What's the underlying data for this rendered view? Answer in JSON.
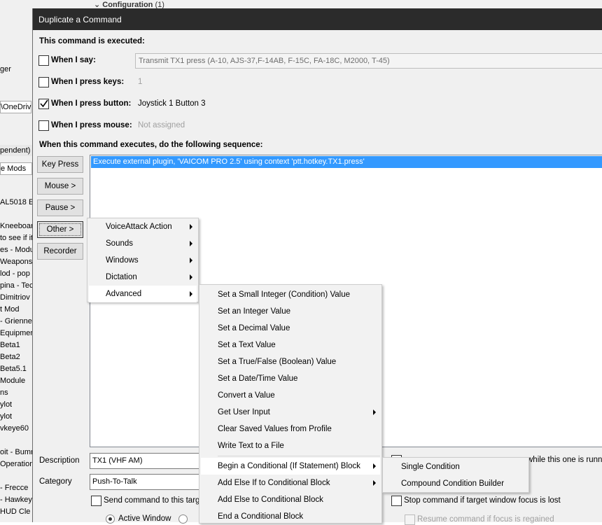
{
  "background": {
    "top_label": "Configuration",
    "top_count": "(1)",
    "left_fragments": [
      "ger",
      "\\OneDriv",
      "pendent) -",
      "e Mods",
      "AL5018 E",
      "Kneeboar",
      "to see if it",
      "es - Modu",
      "Weapons I",
      "lod  - pop",
      "pina - Tec",
      "Dimitriov",
      "t Mod",
      "- Griennel",
      "Equipmen",
      "Beta1",
      "Beta2",
      "Beta5.1",
      "Module",
      "ns",
      "ylot",
      "ylot",
      "vkeye60",
      "oit - Bumm",
      "Operation",
      "- Frecce",
      "- Hawkey",
      "HUD Cle"
    ]
  },
  "dialog": {
    "title": "Duplicate a Command",
    "executed_header": "This command is executed:",
    "when_say": {
      "label": "When I say:",
      "value": "Transmit TX1 press (A-10, AJS-37,F-14AB, F-15C, FA-18C, M2000, T-45)",
      "checked": false
    },
    "when_keys": {
      "label": "When I press keys:",
      "value": "1",
      "checked": false
    },
    "when_button": {
      "label": "When I press button:",
      "value": "Joystick 1 Button 3",
      "checked": true
    },
    "when_mouse": {
      "label": "When I press mouse:",
      "value": "Not assigned",
      "checked": false
    },
    "sequence_header": "When this command executes, do the following sequence:",
    "buttons": {
      "key_press": "Key Press",
      "mouse": "Mouse >",
      "pause": "Pause >",
      "other": "Other >",
      "recorder": "Recorder"
    },
    "sequence_items": [
      "Execute external plugin, 'VAICOM PRO 2.5' using context 'ptt.hotkey.TX1.press'"
    ],
    "description_label": "Description",
    "description_value": "TX1 (VHF AM)",
    "category_label": "Category",
    "category_value": "Push-To-Talk",
    "send_to_target": "Send command to this targ",
    "active_window": "Active Window",
    "right_text_running": "while this one is runni",
    "stop_focus_lost": "Stop command if target window focus is lost",
    "resume_focus": "Resume command if focus is regained"
  },
  "menu_other": [
    "VoiceAttack Action",
    "Sounds",
    "Windows",
    "Dictation",
    "Advanced"
  ],
  "menu_advanced": [
    "Set a Small Integer (Condition) Value",
    "Set an Integer Value",
    "Set a Decimal Value",
    "Set a Text Value",
    "Set a True/False (Boolean) Value",
    "Set a Date/Time Value",
    "Convert a Value",
    "Get User Input",
    "Clear Saved Values from Profile",
    "Write Text to a File",
    "Begin a Conditional (If Statement) Block",
    "Add Else If to Conditional Block",
    "Add Else to Conditional Block",
    "End a Conditional Block"
  ],
  "menu_conditional": [
    "Single Condition",
    "Compound Condition Builder"
  ]
}
